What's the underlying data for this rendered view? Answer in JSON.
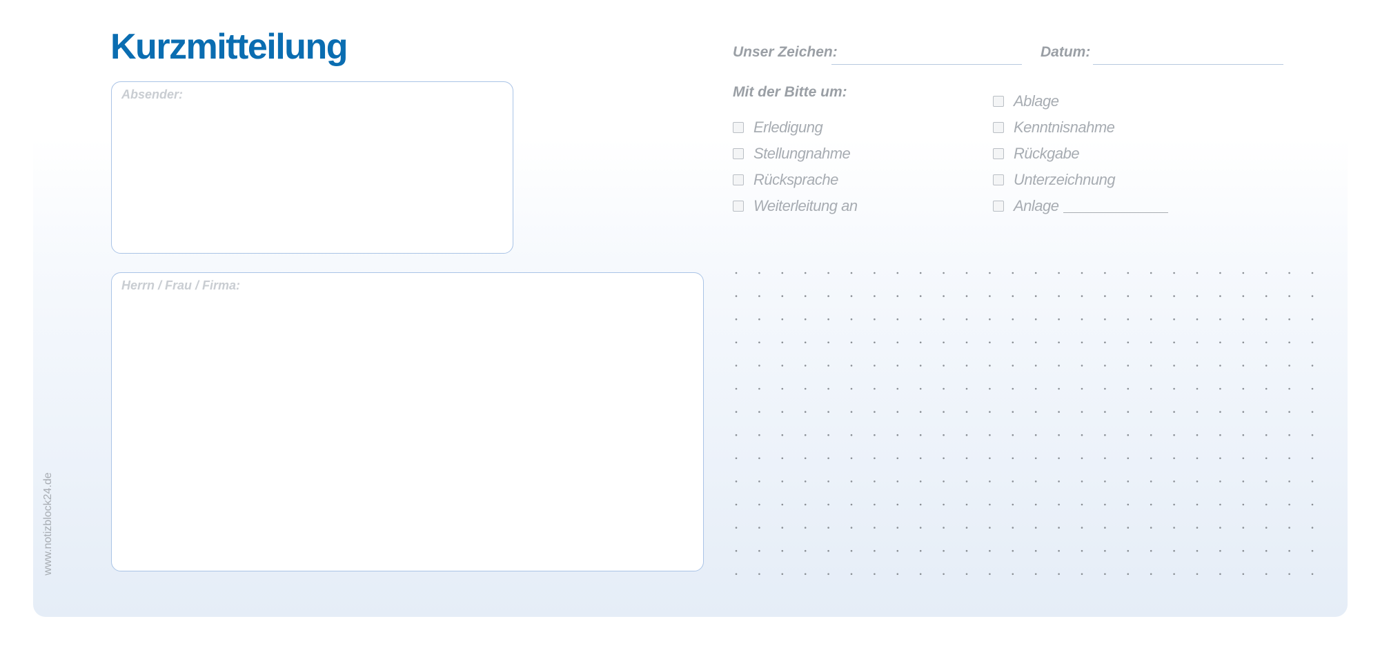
{
  "form": {
    "title": "Kurzmitteilung",
    "sender_label": "Absender:",
    "recipient_label": "Herrn / Frau / Firma:",
    "reference_label": "Unser Zeichen:",
    "date_label": "Datum:",
    "request_label": "Mit der Bitte um:",
    "options_left": [
      "Erledigung",
      "Stellungnahme",
      "Rücksprache",
      "Weiterleitung an"
    ],
    "options_right": [
      "Ablage",
      "Kenntnisnahme",
      "Rückgabe",
      "Unterzeichnung",
      "Anlage"
    ],
    "website": "www.notizblock24.de"
  },
  "colors": {
    "title": "#0a6db1",
    "box_border": "#a9c3e6",
    "label_gray": "#a7acb2",
    "dot": "#8a8f95"
  }
}
